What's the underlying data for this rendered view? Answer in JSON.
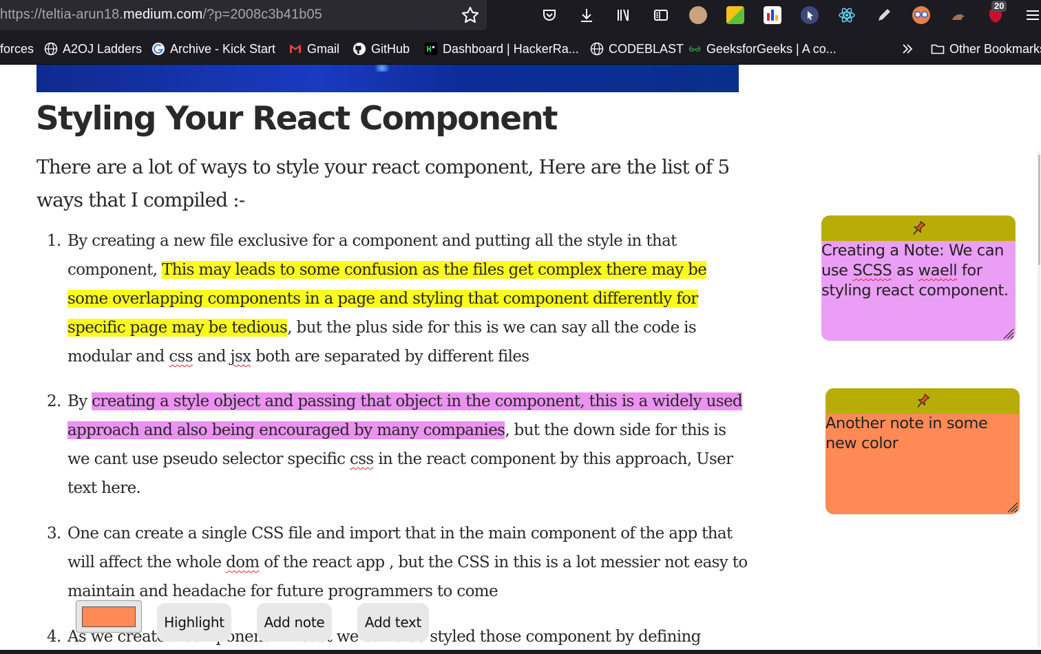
{
  "browser": {
    "url_prefix": "https://teltia-arun18.",
    "url_domain": "medium.com",
    "url_suffix": "/?p=2008c3b41b05",
    "notification_count": "20",
    "accent": "#1c1b22"
  },
  "bookmarks": {
    "items": [
      {
        "label": "forces"
      },
      {
        "label": "A2OJ Ladders"
      },
      {
        "label": "Archive - Kick Start"
      },
      {
        "label": "Gmail"
      },
      {
        "label": "GitHub"
      },
      {
        "label": "Dashboard | HackerRa..."
      },
      {
        "label": "CODEBLAST"
      },
      {
        "label": "GeeksforGeeks | A co..."
      }
    ],
    "overflow_icon": "chevrons-right-icon",
    "other_label": "Other Bookmarks"
  },
  "article": {
    "title": "Styling Your React Component",
    "intro": "There are a lot of ways to style your react component, Here are the list of 5 ways that I compiled :-",
    "items": [
      {
        "num": "1.",
        "a": "By creating a new file exclusive for a component and putting all the style in that component, ",
        "highlight": "This may leads to some confusion as the files get complex there may be some overlapping components in a page and styling that component differently for specific page may be tedious",
        "b": ", but the plus side for this is we can say all the code is modular and ",
        "w1": "css",
        "c": " and ",
        "w2": "jsx",
        "d": " both are separated by different files"
      },
      {
        "num": "2.",
        "a": "By ",
        "highlight": "creating a style object and passing that object in the component, this is a widely used approach and also being encouraged by many companies",
        "b": ", but the down side for this is we cant use pseudo selector specific ",
        "w1": "css",
        "c": " in the react component by this approach, User text here."
      },
      {
        "num": "3.",
        "a": "One can create a single CSS file and import that in the main component of the app that will affect the whole ",
        "w1": "dom",
        "b": " of the react app , but the CSS in this is a lot messier not easy to maintain and headache for future programmers to come"
      },
      {
        "num": "4.",
        "a": "As we create a component in react we can also styled those component by defining"
      }
    ],
    "highlight_colors": {
      "yellow": "#fcfc1c",
      "pink": "#ec92f2"
    }
  },
  "notes": [
    {
      "pre": "Creating a Note: We can use ",
      "w1": "SCSS",
      "mid": " as ",
      "w2": "waell",
      "post": " for styling react component.",
      "color": "#eb9ef5"
    },
    {
      "text": "Another note in some new color",
      "color": "#ff8a55"
    }
  ],
  "controls": {
    "selected_color": "#ff8a55",
    "highlight_label": "Highlight",
    "add_note_label": "Add note",
    "add_text_label": "Add text"
  }
}
